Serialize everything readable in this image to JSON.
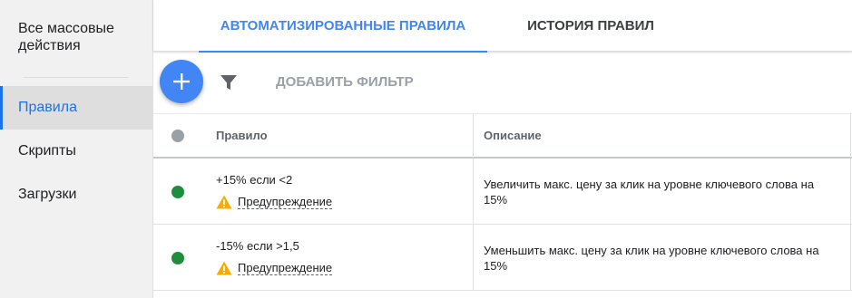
{
  "sidebar": {
    "top_label": "Все массовые действия",
    "items": [
      {
        "label": "Правила",
        "active": true
      },
      {
        "label": "Скрипты",
        "active": false
      },
      {
        "label": "Загрузки",
        "active": false
      }
    ]
  },
  "tabs": [
    {
      "label": "АВТОМАТИЗИРОВАННЫЕ ПРАВИЛА",
      "active": true
    },
    {
      "label": "ИСТОРИЯ ПРАВИЛ",
      "active": false
    }
  ],
  "toolbar": {
    "fab_icon": "plus-icon",
    "filter_icon": "filter-icon",
    "add_filter_label": "ДОБАВИТЬ ФИЛЬТР"
  },
  "table": {
    "columns": [
      "Правило",
      "Описание"
    ],
    "rows": [
      {
        "status_color": "#1e8e3e",
        "rule": "+15% если <2",
        "warning": "Предупреждение",
        "description": "Увеличить макс. цену за клик на уровне ключевого слова на 15%"
      },
      {
        "status_color": "#1e8e3e",
        "rule": "-15% если >1,5",
        "warning": "Предупреждение",
        "description": "Уменьшить макс. цену за клик на уровне ключевого слова на 15%"
      }
    ]
  },
  "colors": {
    "accent": "#4285f4",
    "status_active": "#1e8e3e",
    "header_status_dot": "#9aa0a6",
    "warning": "#f9ab00"
  }
}
